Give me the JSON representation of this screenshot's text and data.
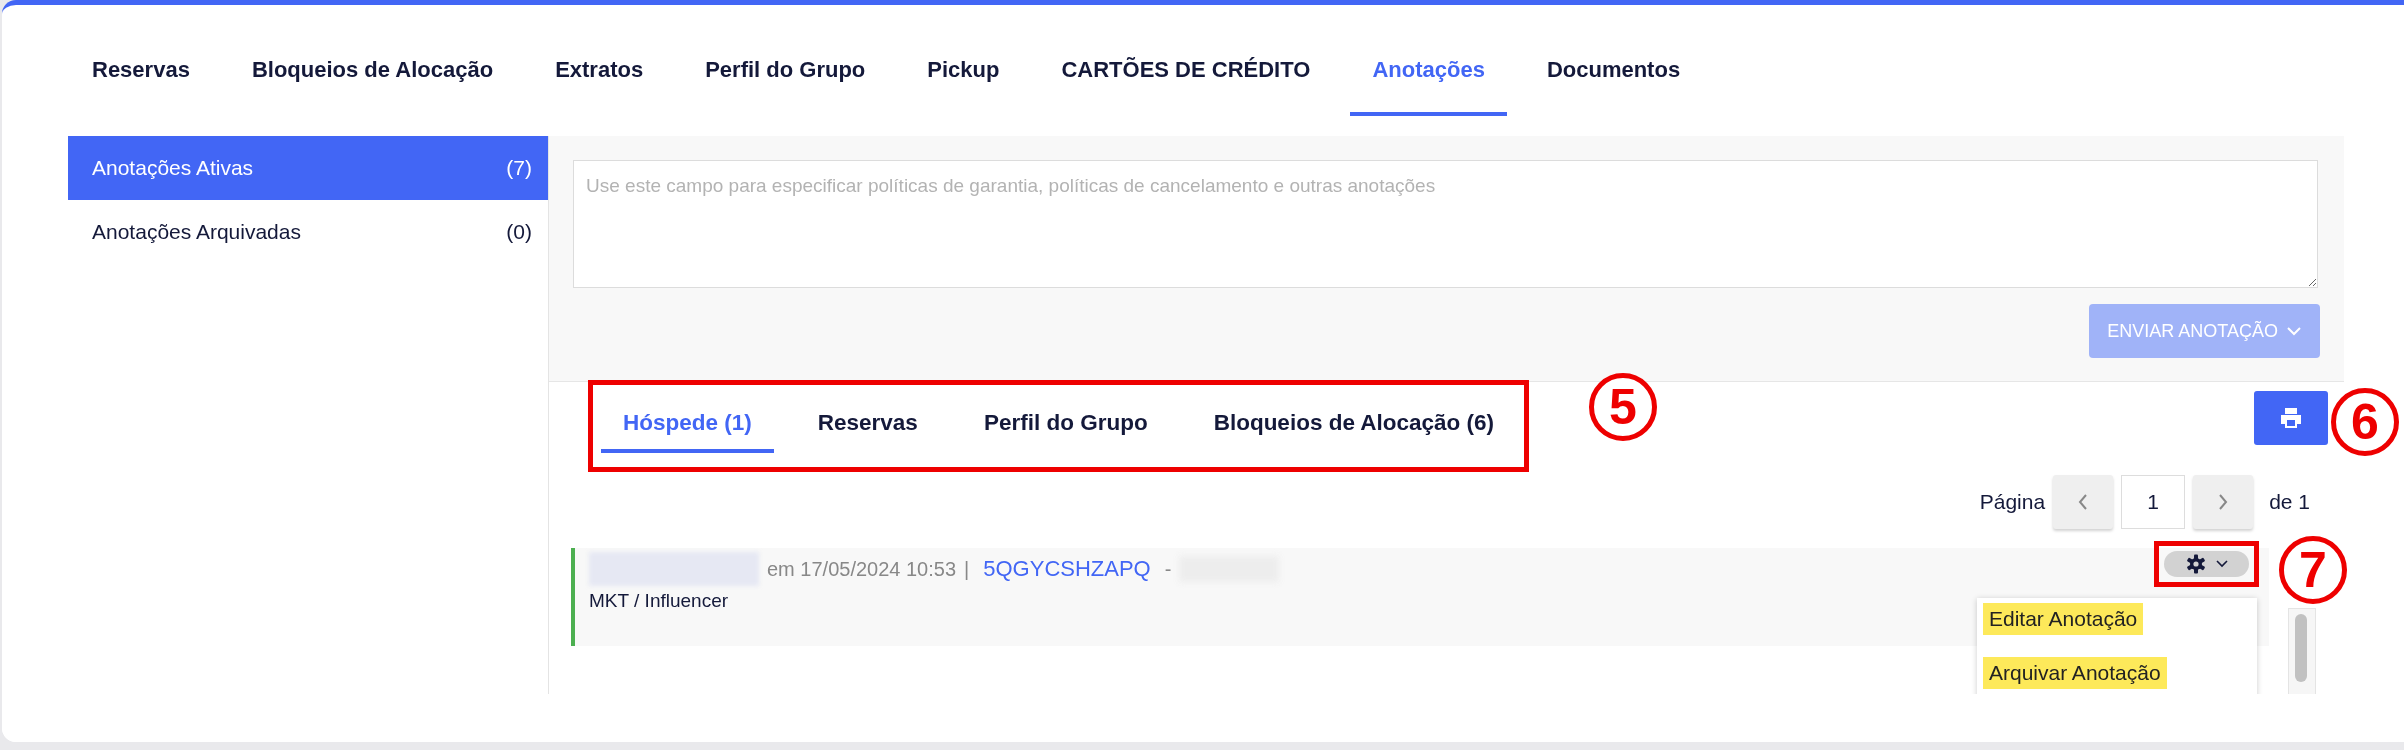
{
  "tabs": [
    {
      "label": "Reservas",
      "selected": false
    },
    {
      "label": "Bloqueios de Alocação",
      "selected": false
    },
    {
      "label": "Extratos",
      "selected": false
    },
    {
      "label": "Perfil do Grupo",
      "selected": false
    },
    {
      "label": "Pickup",
      "selected": false
    },
    {
      "label": "CARTÕES DE CRÉDITO",
      "selected": false
    },
    {
      "label": "Anotações",
      "selected": true
    },
    {
      "label": "Documentos",
      "selected": false
    }
  ],
  "sidebar": {
    "items": [
      {
        "label": "Anotações Ativas",
        "count": "(7)",
        "selected": true
      },
      {
        "label": "Anotações Arquivadas",
        "count": "(0)",
        "selected": false
      }
    ]
  },
  "editor": {
    "placeholder": "Use este campo para especificar políticas de garantia, políticas de cancelamento e outras anotações",
    "submit_button": "ENVIAR ANOTAÇÃO",
    "disabled": true
  },
  "note_tabs": [
    {
      "label": "Hóspede (1)",
      "selected": true
    },
    {
      "label": "Reservas",
      "selected": false
    },
    {
      "label": "Perfil do Grupo",
      "selected": false
    },
    {
      "label": "Bloqueios de Alocação (6)",
      "selected": false
    }
  ],
  "pager": {
    "label": "Página",
    "page": "1",
    "total": "de 1"
  },
  "notes": [
    {
      "meta": "em 17/05/2024 10:53",
      "separator": "|",
      "reservation": "5QGYCSHZAPQ",
      "dash": "-",
      "text": "MKT / Influencer"
    }
  ],
  "note_menu": {
    "items": [
      {
        "label": "Editar Anotação",
        "highlighted": true
      },
      {
        "label": "Arquivar Anotação",
        "highlighted": true
      }
    ]
  },
  "callouts": [
    {
      "number": "5",
      "framed": true
    },
    {
      "number": "6",
      "framed": false
    },
    {
      "number": "7",
      "framed": true
    }
  ]
}
